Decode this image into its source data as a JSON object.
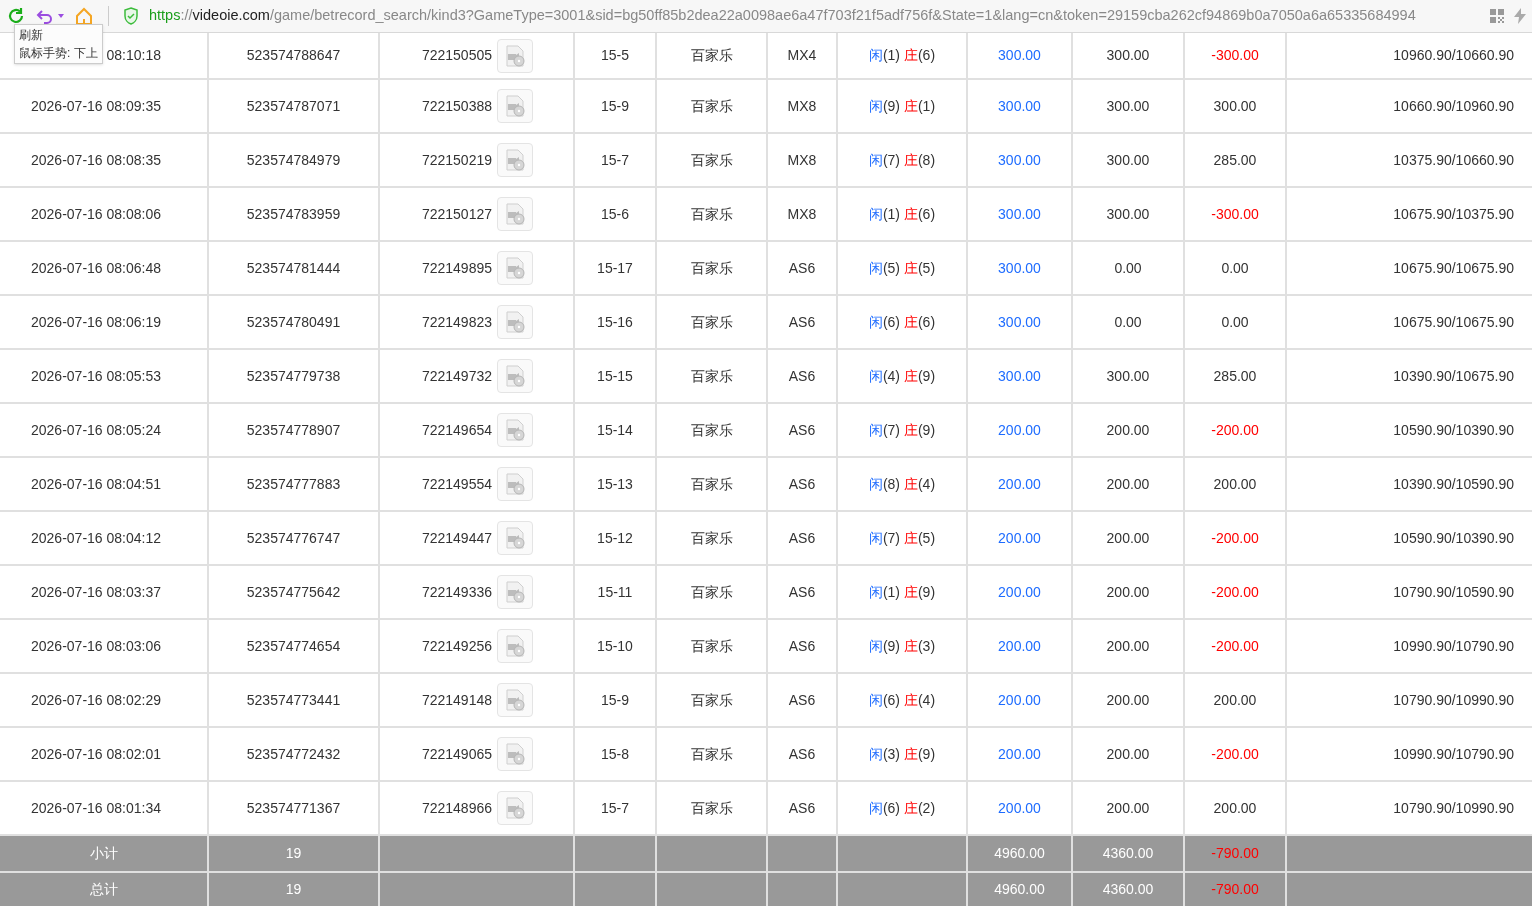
{
  "browser": {
    "url": {
      "scheme": "https",
      "separator": "://",
      "host": "videoie.com",
      "path": "/game/betrecord_search/kind3?GameType=3001&sid=bg50ff85b2dea22a0098ae6a47f703f21f5adf756f&State=1&lang=cn&token=29159cba262cf94869b0a7050a6a65335684994"
    },
    "tooltip": [
      "刷新",
      "鼠标手势: 下上"
    ]
  },
  "rows": [
    {
      "time": "08:10:18",
      "bet_id": "523574788647",
      "round_id": "722150505",
      "shoe": "15-5",
      "game": "百家乐",
      "table": "MX4",
      "player_label": "闲",
      "player": "(1)",
      "banker_label": "庄",
      "banker": "(6)",
      "bet": "300.00",
      "valid": "300.00",
      "win_loss": "-300.00",
      "loss": true,
      "balance": "10960.90/10660.90"
    },
    {
      "time": "2026-07-16 08:09:35",
      "bet_id": "523574787071",
      "round_id": "722150388",
      "shoe": "15-9",
      "game": "百家乐",
      "table": "MX8",
      "player_label": "闲",
      "player": "(9)",
      "banker_label": "庄",
      "banker": "(1)",
      "bet": "300.00",
      "valid": "300.00",
      "win_loss": "300.00",
      "loss": false,
      "balance": "10660.90/10960.90"
    },
    {
      "time": "2026-07-16 08:08:35",
      "bet_id": "523574784979",
      "round_id": "722150219",
      "shoe": "15-7",
      "game": "百家乐",
      "table": "MX8",
      "player_label": "闲",
      "player": "(7)",
      "banker_label": "庄",
      "banker": "(8)",
      "bet": "300.00",
      "valid": "300.00",
      "win_loss": "285.00",
      "loss": false,
      "balance": "10375.90/10660.90"
    },
    {
      "time": "2026-07-16 08:08:06",
      "bet_id": "523574783959",
      "round_id": "722150127",
      "shoe": "15-6",
      "game": "百家乐",
      "table": "MX8",
      "player_label": "闲",
      "player": "(1)",
      "banker_label": "庄",
      "banker": "(6)",
      "bet": "300.00",
      "valid": "300.00",
      "win_loss": "-300.00",
      "loss": true,
      "balance": "10675.90/10375.90"
    },
    {
      "time": "2026-07-16 08:06:48",
      "bet_id": "523574781444",
      "round_id": "722149895",
      "shoe": "15-17",
      "game": "百家乐",
      "table": "AS6",
      "player_label": "闲",
      "player": "(5)",
      "banker_label": "庄",
      "banker": "(5)",
      "bet": "300.00",
      "valid": "0.00",
      "win_loss": "0.00",
      "loss": false,
      "balance": "10675.90/10675.90"
    },
    {
      "time": "2026-07-16 08:06:19",
      "bet_id": "523574780491",
      "round_id": "722149823",
      "shoe": "15-16",
      "game": "百家乐",
      "table": "AS6",
      "player_label": "闲",
      "player": "(6)",
      "banker_label": "庄",
      "banker": "(6)",
      "bet": "300.00",
      "valid": "0.00",
      "win_loss": "0.00",
      "loss": false,
      "balance": "10675.90/10675.90"
    },
    {
      "time": "2026-07-16 08:05:53",
      "bet_id": "523574779738",
      "round_id": "722149732",
      "shoe": "15-15",
      "game": "百家乐",
      "table": "AS6",
      "player_label": "闲",
      "player": "(4)",
      "banker_label": "庄",
      "banker": "(9)",
      "bet": "300.00",
      "valid": "300.00",
      "win_loss": "285.00",
      "loss": false,
      "balance": "10390.90/10675.90"
    },
    {
      "time": "2026-07-16 08:05:24",
      "bet_id": "523574778907",
      "round_id": "722149654",
      "shoe": "15-14",
      "game": "百家乐",
      "table": "AS6",
      "player_label": "闲",
      "player": "(7)",
      "banker_label": "庄",
      "banker": "(9)",
      "bet": "200.00",
      "valid": "200.00",
      "win_loss": "-200.00",
      "loss": true,
      "balance": "10590.90/10390.90"
    },
    {
      "time": "2026-07-16 08:04:51",
      "bet_id": "523574777883",
      "round_id": "722149554",
      "shoe": "15-13",
      "game": "百家乐",
      "table": "AS6",
      "player_label": "闲",
      "player": "(8)",
      "banker_label": "庄",
      "banker": "(4)",
      "bet": "200.00",
      "valid": "200.00",
      "win_loss": "200.00",
      "loss": false,
      "balance": "10390.90/10590.90"
    },
    {
      "time": "2026-07-16 08:04:12",
      "bet_id": "523574776747",
      "round_id": "722149447",
      "shoe": "15-12",
      "game": "百家乐",
      "table": "AS6",
      "player_label": "闲",
      "player": "(7)",
      "banker_label": "庄",
      "banker": "(5)",
      "bet": "200.00",
      "valid": "200.00",
      "win_loss": "-200.00",
      "loss": true,
      "balance": "10590.90/10390.90"
    },
    {
      "time": "2026-07-16 08:03:37",
      "bet_id": "523574775642",
      "round_id": "722149336",
      "shoe": "15-11",
      "game": "百家乐",
      "table": "AS6",
      "player_label": "闲",
      "player": "(1)",
      "banker_label": "庄",
      "banker": "(9)",
      "bet": "200.00",
      "valid": "200.00",
      "win_loss": "-200.00",
      "loss": true,
      "balance": "10790.90/10590.90"
    },
    {
      "time": "2026-07-16 08:03:06",
      "bet_id": "523574774654",
      "round_id": "722149256",
      "shoe": "15-10",
      "game": "百家乐",
      "table": "AS6",
      "player_label": "闲",
      "player": "(9)",
      "banker_label": "庄",
      "banker": "(3)",
      "bet": "200.00",
      "valid": "200.00",
      "win_loss": "-200.00",
      "loss": true,
      "balance": "10990.90/10790.90"
    },
    {
      "time": "2026-07-16 08:02:29",
      "bet_id": "523574773441",
      "round_id": "722149148",
      "shoe": "15-9",
      "game": "百家乐",
      "table": "AS6",
      "player_label": "闲",
      "player": "(6)",
      "banker_label": "庄",
      "banker": "(4)",
      "bet": "200.00",
      "valid": "200.00",
      "win_loss": "200.00",
      "loss": false,
      "balance": "10790.90/10990.90"
    },
    {
      "time": "2026-07-16 08:02:01",
      "bet_id": "523574772432",
      "round_id": "722149065",
      "shoe": "15-8",
      "game": "百家乐",
      "table": "AS6",
      "player_label": "闲",
      "player": "(3)",
      "banker_label": "庄",
      "banker": "(9)",
      "bet": "200.00",
      "valid": "200.00",
      "win_loss": "-200.00",
      "loss": true,
      "balance": "10990.90/10790.90"
    },
    {
      "time": "2026-07-16 08:01:34",
      "bet_id": "523574771367",
      "round_id": "722148966",
      "shoe": "15-7",
      "game": "百家乐",
      "table": "AS6",
      "player_label": "闲",
      "player": "(6)",
      "banker_label": "庄",
      "banker": "(2)",
      "bet": "200.00",
      "valid": "200.00",
      "win_loss": "200.00",
      "loss": false,
      "balance": "10790.90/10990.90"
    }
  ],
  "totals": [
    {
      "label": "小计",
      "count": "19",
      "bet": "4960.00",
      "valid": "4360.00",
      "win_loss": "-790.00",
      "loss": true
    },
    {
      "label": "总计",
      "count": "19",
      "bet": "4960.00",
      "valid": "4360.00",
      "win_loss": "-790.00",
      "loss": true
    }
  ]
}
